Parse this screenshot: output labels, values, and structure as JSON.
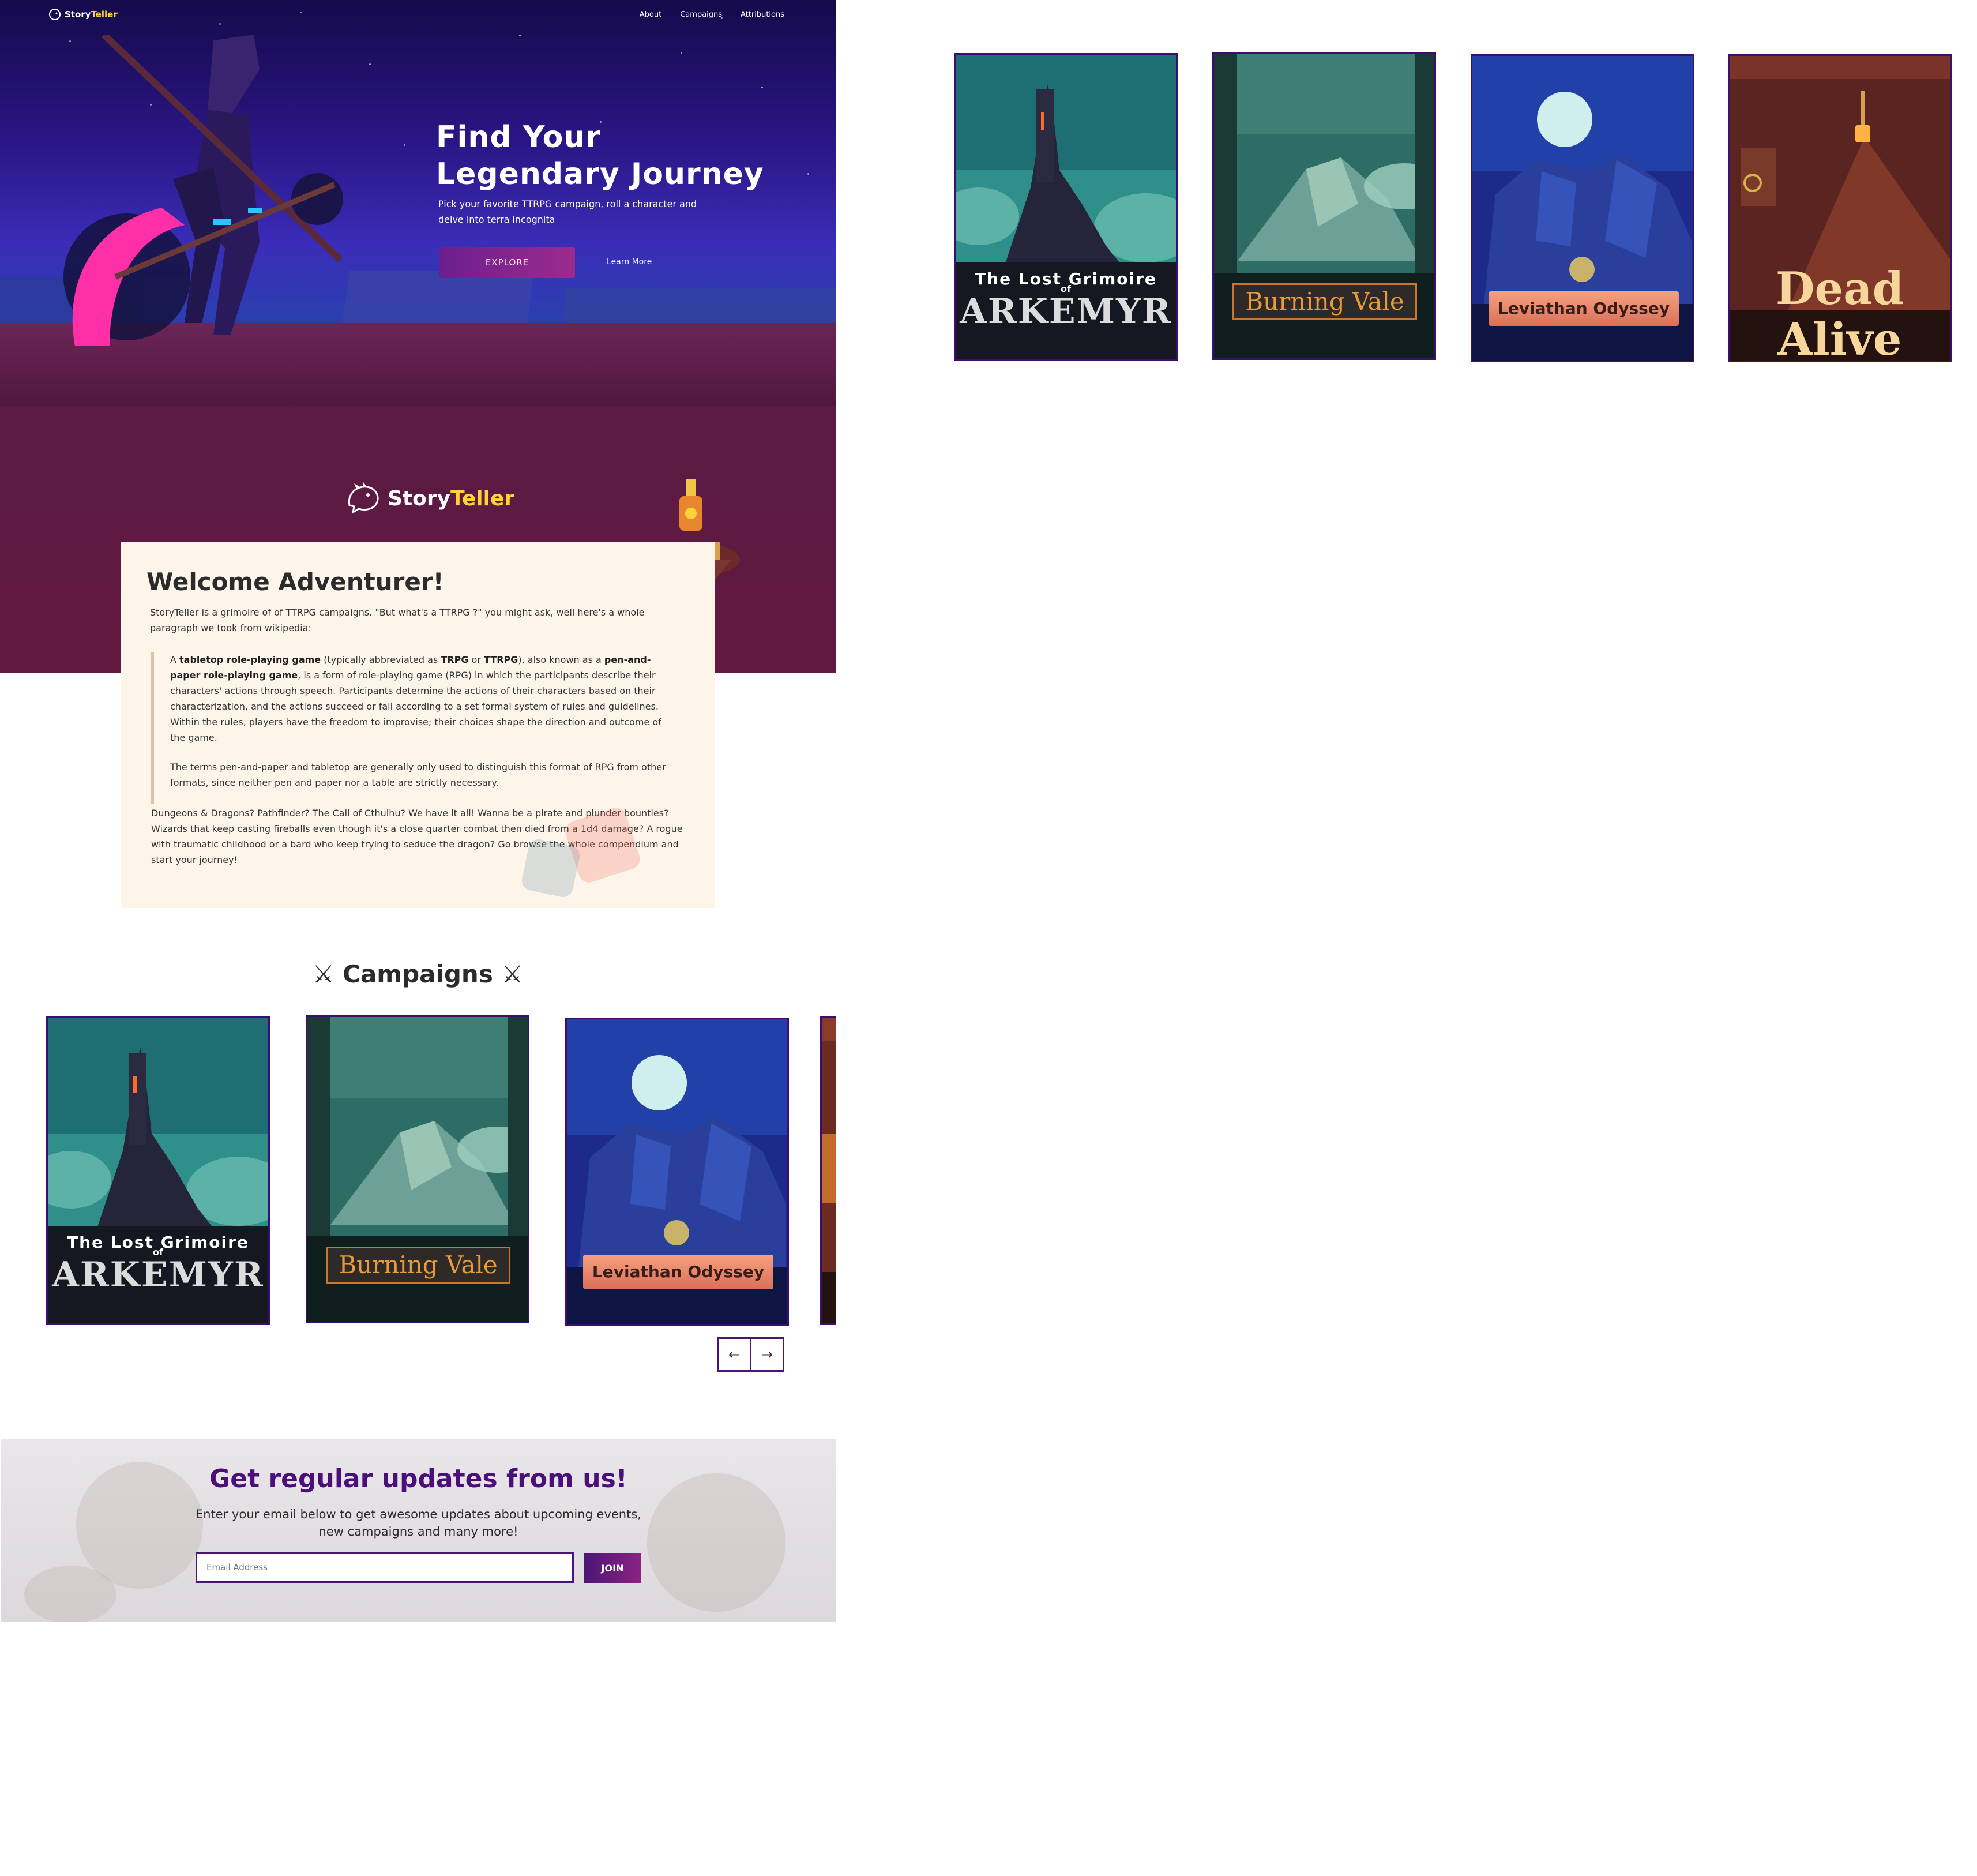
{
  "nav": {
    "brand_part1": "Story",
    "brand_part2": "Teller",
    "links": [
      "About",
      "Campaigns",
      "Attributions"
    ]
  },
  "hero": {
    "title_line1": "Find Your",
    "title_line2": "Legendary Journey",
    "subtitle_line1": "Pick your favorite TTRPG campaign, roll a character and",
    "subtitle_line2": "delve into terra incognita",
    "explore_label": "EXPLORE",
    "learn_more_label": "Learn More"
  },
  "welcome": {
    "brand_part1": "Story",
    "brand_part2": "Teller",
    "title": "Welcome Adventurer!",
    "intro": "StoryTeller is a grimoire of of TTRPG campaigns. \"But what's a TTRPG ?\" you might ask, well here's a whole paragraph we took from wikipedia:",
    "quote": {
      "p1_a": "A ",
      "p1_b": "tabletop role-playing game",
      "p1_c": " (typically abbreviated as ",
      "p1_d": "TRPG",
      "p1_e": " or ",
      "p1_f": "TTRPG",
      "p1_g": "), also known as a ",
      "p1_h": "pen-and-paper role-playing game",
      "p1_i": ", is a form of role-playing game (RPG) in which the participants describe their characters' actions through speech. Participants determine the actions of their characters based on their characterization, and the actions succeed or fail according to a set formal system of rules and guidelines. Within the rules, players have the freedom to improvise; their choices shape the direction and outcome of the game.",
      "p2": "The terms pen-and-paper and tabletop are generally only used to distinguish this format of RPG from other formats, since neither pen and paper nor a table are strictly necessary."
    },
    "outro": "Dungeons & Dragons? Pathfinder? The Call of Cthulhu? We have it all! Wanna be a pirate and plunder bounties? Wizards that keep casting fireballs even though it's a close quarter combat then died from a 1d4 damage? A rogue with traumatic childhood or a bard who keep trying to seduce the dragon? Go browse the whole compendium and start your journey!"
  },
  "campaigns": {
    "title": "Campaigns",
    "icon": "crossed-swords-icon",
    "items": [
      {
        "title_line1": "The Lost Grimoire",
        "title_line2": "of",
        "title_line3": "ARKEMYR"
      },
      {
        "title": "Burning Vale"
      },
      {
        "title": "Leviathan Odyssey"
      },
      {
        "title_line1": "Dead",
        "title_line2": "Alive"
      }
    ],
    "prev_label": "←",
    "next_label": "→"
  },
  "newsletter": {
    "title": "Get regular updates from us!",
    "subtitle_line1": "Enter your email below to get awesome updates about upcoming events,",
    "subtitle_line2": "new campaigns and many more!",
    "placeholder": "Email Address",
    "join_label": "JOIN"
  },
  "colors": {
    "brand_highlight": "#ffd23a",
    "accent_purple": "#4a1675",
    "welcome_bg": "#5a1a44",
    "card_bg": "#fdf4ea"
  }
}
